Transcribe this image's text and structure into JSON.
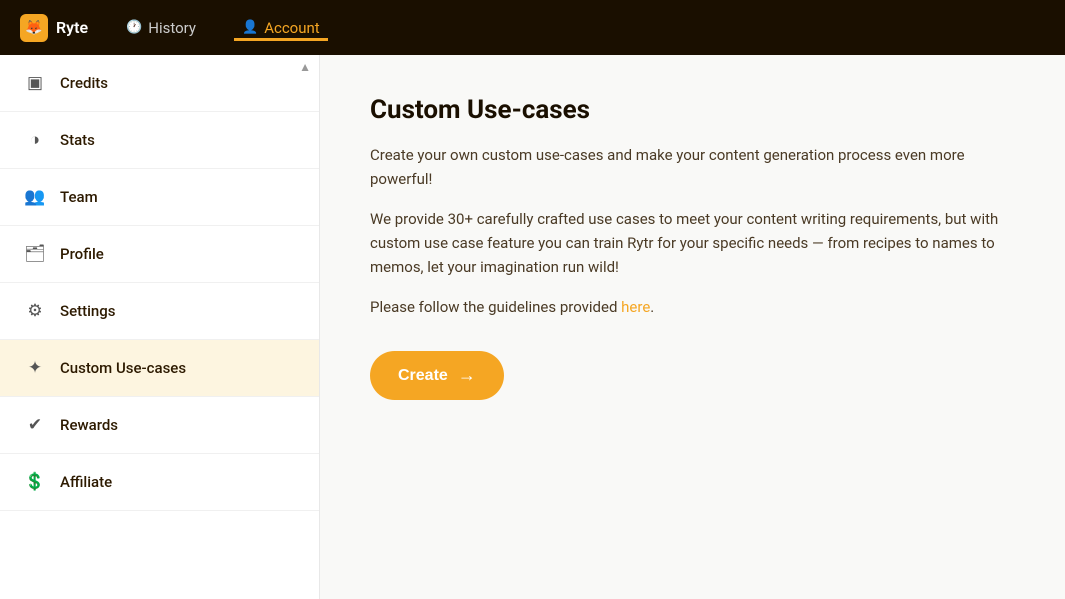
{
  "topNav": {
    "logo": {
      "icon": "🦊",
      "label": "Ryte"
    },
    "items": [
      {
        "id": "history",
        "label": "History",
        "icon": "🕐",
        "active": false
      },
      {
        "id": "account",
        "label": "Account",
        "icon": "👤",
        "active": true
      }
    ]
  },
  "sidebar": {
    "items": [
      {
        "id": "credits",
        "label": "Credits",
        "icon": "▣",
        "active": false
      },
      {
        "id": "stats",
        "label": "Stats",
        "icon": "◑",
        "active": false
      },
      {
        "id": "team",
        "label": "Team",
        "icon": "👥",
        "active": false
      },
      {
        "id": "profile",
        "label": "Profile",
        "icon": "🗂",
        "active": false
      },
      {
        "id": "settings",
        "label": "Settings",
        "icon": "⚙",
        "active": false
      },
      {
        "id": "custom-use-cases",
        "label": "Custom Use-cases",
        "icon": "✦",
        "active": true
      },
      {
        "id": "rewards",
        "label": "Rewards",
        "icon": "✔",
        "active": false
      },
      {
        "id": "affiliate",
        "label": "Affiliate",
        "icon": "💲",
        "active": false
      }
    ]
  },
  "content": {
    "title": "Custom Use-cases",
    "description1": "Create your own custom use-cases and make your content generation process even more powerful!",
    "description2": "We provide 30+ carefully crafted use cases to meet your content writing requirements, but with custom use case feature you can train Rytr for your specific needs — from recipes to names to memos, let your imagination run wild!",
    "description3_prefix": "Please follow the guidelines provided ",
    "link_label": "here",
    "description3_suffix": ".",
    "create_button": "Create",
    "create_arrow": "→"
  }
}
